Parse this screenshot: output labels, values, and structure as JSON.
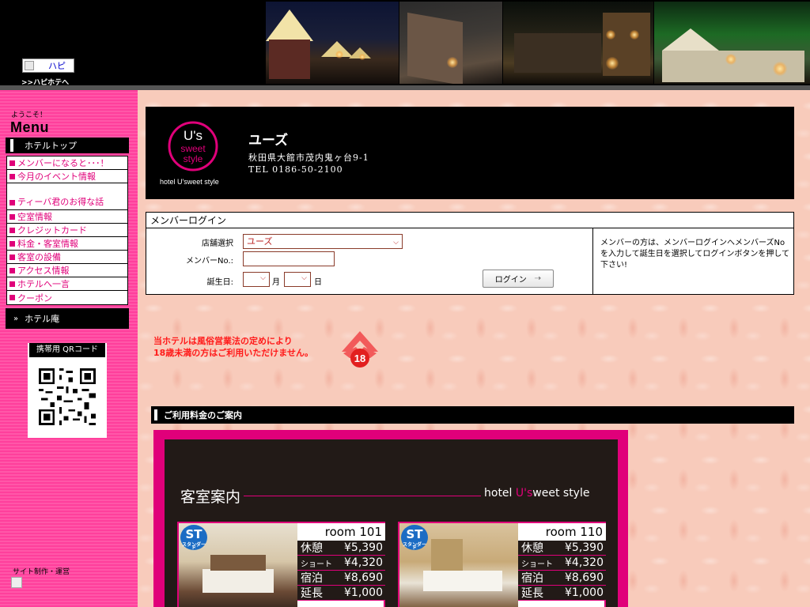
{
  "header": {
    "logo_alt": "ハピ",
    "hapi_link": ">>ハピホテへ"
  },
  "sidebar": {
    "welcome": "ようこそ！",
    "menu_title": "Menu",
    "top_item": "ホテルトップ",
    "items": [
      {
        "label": "メンバーになると･･･！"
      },
      {
        "label": "今月のイベント情報"
      },
      {
        "label": "ティーバ君のお得な話"
      },
      {
        "label": "空室情報"
      },
      {
        "label": "クレジットカード"
      },
      {
        "label": "料金・客室情報"
      },
      {
        "label": "客室の設備"
      },
      {
        "label": "アクセス情報"
      },
      {
        "label": "ホテルへ一言"
      },
      {
        "label": "クーポン"
      }
    ],
    "hotel_an": "ホテル庵",
    "qr_label": "携帯用 QRコード",
    "credit": "サイト制作・運営"
  },
  "hotel": {
    "logo_text_1": "U's",
    "logo_text_2": "sweet",
    "logo_text_3": "style",
    "logo_caption": "hotel U'sweet style",
    "name": "ユーズ",
    "address": "秋田県大館市茂内鬼ヶ台9-1",
    "tel": "TEL 0186-50-2100"
  },
  "login": {
    "title": "メンバーログイン",
    "shop_label": "店舗選択",
    "shop_value": "ユーズ",
    "member_no_label": "メンバーNo.:",
    "birthday_label": "誕生日:",
    "month_unit": "月",
    "day_unit": "日",
    "button": "ログイン",
    "note": "メンバーの方は、メンバーログインへメンバーズNoを入力して誕生日を選択してログインボタンを押して下さい!"
  },
  "warning": {
    "line1": "当ホテルは風俗営業法の定めにより",
    "line2": "18歳未満の方はご利用いただけません。",
    "badge": "18"
  },
  "pricing": {
    "section_title": "ご利用料金のご案内",
    "heading": "客室案内",
    "brand_prefix": "hotel ",
    "brand_us": "U's",
    "brand_suffix": "weet style",
    "rooms": [
      {
        "badge": "ST",
        "badge_sub": "スタンダード",
        "name": "room 101",
        "rates": [
          {
            "k": "休憩",
            "v": "¥5,390"
          },
          {
            "k": "ショート",
            "v": "¥4,320"
          },
          {
            "k": "宿泊",
            "v": "¥8,690"
          },
          {
            "k": "延長",
            "v": "¥1,000"
          }
        ]
      },
      {
        "badge": "ST",
        "badge_sub": "スタンダード",
        "name": "room 110",
        "rates": [
          {
            "k": "休憩",
            "v": "¥5,390"
          },
          {
            "k": "ショート",
            "v": "¥4,320"
          },
          {
            "k": "宿泊",
            "v": "¥8,690"
          },
          {
            "k": "延長",
            "v": "¥1,000"
          }
        ]
      }
    ]
  },
  "colors": {
    "accent_pink": "#e0007a",
    "sidebar_pink": "#ff3f9c",
    "warning_red": "#ff1a1a",
    "main_bg": "#f8cbbb"
  }
}
